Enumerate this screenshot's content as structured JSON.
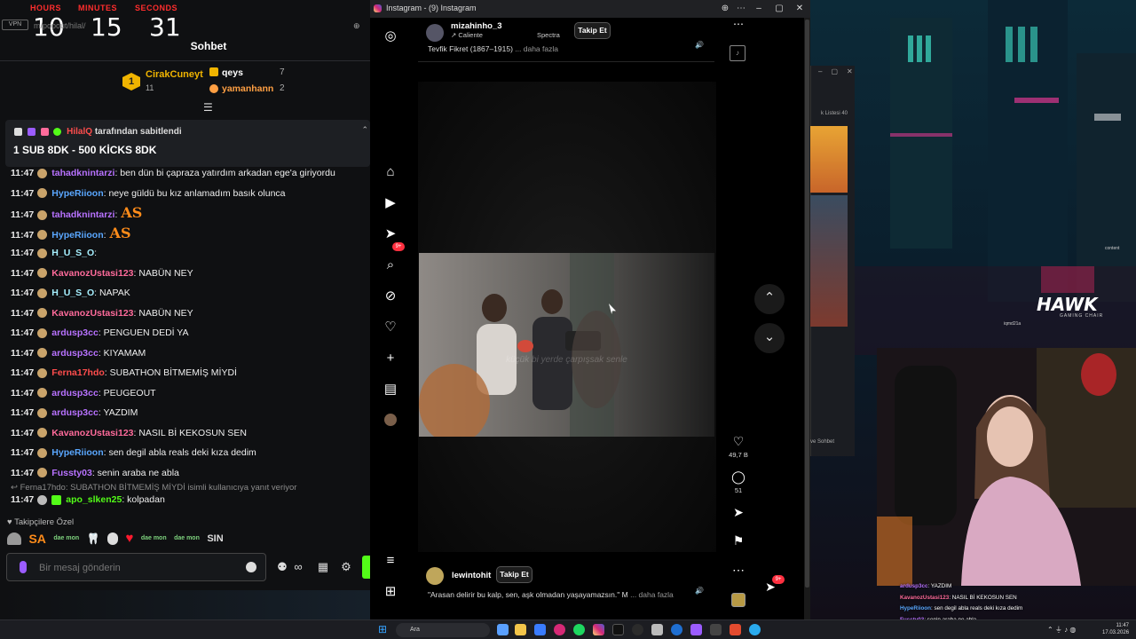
{
  "timer": {
    "labels": [
      "HOURS",
      "MINUTES",
      "SECONDS"
    ],
    "hours": "10",
    "minutes": "15",
    "seconds": "31"
  },
  "chat": {
    "title": "Sohbet",
    "url_fragment": "m/popout/hilal/",
    "top_gifters": [
      {
        "rank": "1",
        "name": "CirakCuneyt",
        "count": "11",
        "color": "#f0b400"
      },
      {
        "name": "qeys",
        "count": "7",
        "color": "#ffffff"
      },
      {
        "name": "yamanhann",
        "count": "2",
        "color": "#ff9f43"
      }
    ],
    "pinned": {
      "pinner": "HilalQ",
      "pinned_by_suffix": "tarafından sabitlendi",
      "message": "1 SUB 8DK - 500 KİCKS 8DK"
    },
    "messages": [
      {
        "time": "11:47",
        "user": "tahadknintarzi",
        "color": "#b872ff",
        "text": ": ben dün bi çapraza yatırdım arkadan ege'a giriyordu"
      },
      {
        "time": "11:47",
        "user": "HypeRiioon",
        "color": "#5aa7ff",
        "text": ": neye güldü bu kız anlamadım basık olunca"
      },
      {
        "time": "11:47",
        "user": "tahadknintarzi",
        "color": "#b872ff",
        "text": ":",
        "emote": "AS"
      },
      {
        "time": "11:47",
        "user": "HypeRiioon",
        "color": "#5aa7ff",
        "text": ":",
        "emote": "AS"
      },
      {
        "time": "11:47",
        "user": "H_U_S_O",
        "color": "#a6f0ff",
        "text": ":"
      },
      {
        "time": "11:47",
        "user": "KavanozUstasi123",
        "color": "#ff6b9b",
        "text": ": NABÜN NEY"
      },
      {
        "time": "11:47",
        "user": "H_U_S_O",
        "color": "#a6f0ff",
        "text": ": NAPAK"
      },
      {
        "time": "11:47",
        "user": "KavanozUstasi123",
        "color": "#ff6b9b",
        "text": ": NABÜN NEY"
      },
      {
        "time": "11:47",
        "user": "ardusp3cc",
        "color": "#b872ff",
        "text": ": PENGUEN DEDİ YA"
      },
      {
        "time": "11:47",
        "user": "ardusp3cc",
        "color": "#b872ff",
        "text": ": KIYAMAM"
      },
      {
        "time": "11:47",
        "user": "Ferna17hdo",
        "color": "#ff4d4d",
        "text": ": SUBATHON BİTMEMİŞ MİYDİ"
      },
      {
        "time": "11:47",
        "user": "ardusp3cc",
        "color": "#b872ff",
        "text": ": PEUGEOUT"
      },
      {
        "time": "11:47",
        "user": "ardusp3cc",
        "color": "#b872ff",
        "text": ": YAZDIM"
      },
      {
        "time": "11:47",
        "user": "KavanozUstasi123",
        "color": "#ff6b9b",
        "text": ": NASIL Bİ KEKOSUN SEN"
      },
      {
        "time": "11:47",
        "user": "HypeRiioon",
        "color": "#5aa7ff",
        "text": ": sen degil abla reals deki kıza dedim"
      },
      {
        "time": "11:47",
        "user": "Fussty03",
        "color": "#b872ff",
        "text": ": senin araba ne abla"
      }
    ],
    "reply_hint": "Ferna17hdo: SUBATHON BİTMEMİŞ MİYDİ isimli kullanıcıya yanıt veriyor",
    "last_message": {
      "time": "11:47",
      "user": "apo_slken25",
      "color": "#53fc18",
      "text": ": kolpadan"
    },
    "followers_only": "Takipçilere Özel",
    "emotes": [
      "SA",
      "dae mon",
      "SIN"
    ],
    "input_placeholder": "Bir mesaj gönderin"
  },
  "instagram": {
    "window_title": "Instagram - (9) Instagram",
    "top_post": {
      "username": "mizahinho_3",
      "subline": "Caliente",
      "audio": "Spectra",
      "follow": "Takip Et",
      "caption": "Tevfik Fikret (1867–1915)",
      "more": "... daha fazla"
    },
    "video_subtitle": "küçük bi yerde çarpışsak senle",
    "actions": {
      "likes": "49,7 B",
      "comments": "51"
    },
    "notif_badge": "9+",
    "dm_badge": "9+",
    "bottom_post": {
      "username": "lewintohit",
      "follow": "Takip Et",
      "caption": "\"Arasan delirir bu kalp, sen, aşk olmadan yaşayamazsın.\" M",
      "more": "... daha fazla"
    }
  },
  "stream": {
    "mini_title": "k Listesi 40",
    "mini_sohbet": "ve Sohbet",
    "hawk": "HAWK",
    "hawk_sub": "GAMING CHAIR",
    "iqmd": "iqmd21a",
    "content": "content",
    "cam_chat": [
      {
        "name": "ardusp3cc",
        "text": ": YAZDIM"
      },
      {
        "name": "KavanozUstasi123",
        "text": ": NASIL Bİ KEKOSUN SEN"
      },
      {
        "name": "HypeRiioon",
        "text": ": sen degil abla reals deki kıza dedim"
      },
      {
        "name": "Fussty03",
        "text": ": senin araba ne abla"
      },
      {
        "name": "apo_slken25",
        "text": ": kolpadan"
      }
    ]
  },
  "taskbar": {
    "search": "Ara",
    "time": "11:47",
    "date": "17.03.2026"
  }
}
